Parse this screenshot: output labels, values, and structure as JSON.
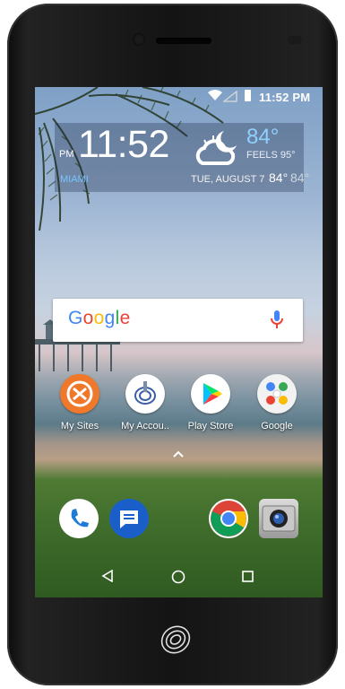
{
  "status_bar": {
    "time": "11:52 PM",
    "icons": [
      "wifi-icon",
      "signal-icon",
      "battery-icon"
    ]
  },
  "weather_widget": {
    "ampm": "PM",
    "time": "11:52",
    "temperature": "84°",
    "feels_like": "FEELS 95°",
    "location": "MIAMI",
    "date": "TUE, AUGUST 7",
    "high": "84°",
    "low": "84°",
    "icon": "partly-cloudy-night-icon"
  },
  "search": {
    "logo": "Google",
    "icon": "mic-icon"
  },
  "apps": [
    {
      "label": "My Sites",
      "icon": "my-sites-icon"
    },
    {
      "label": "My Accou..",
      "icon": "my-account-icon"
    },
    {
      "label": "Play Store",
      "icon": "play-store-icon"
    },
    {
      "label": "Google",
      "icon": "google-folder-icon"
    }
  ],
  "dock": [
    "phone-icon",
    "messages-icon",
    "chrome-icon",
    "camera-icon"
  ],
  "navigation": [
    "back-icon",
    "home-icon",
    "recents-icon"
  ],
  "colors": {
    "weather_accent": "#8fd0ff",
    "city_accent": "#79c5ff",
    "orange": "#f0782a"
  }
}
